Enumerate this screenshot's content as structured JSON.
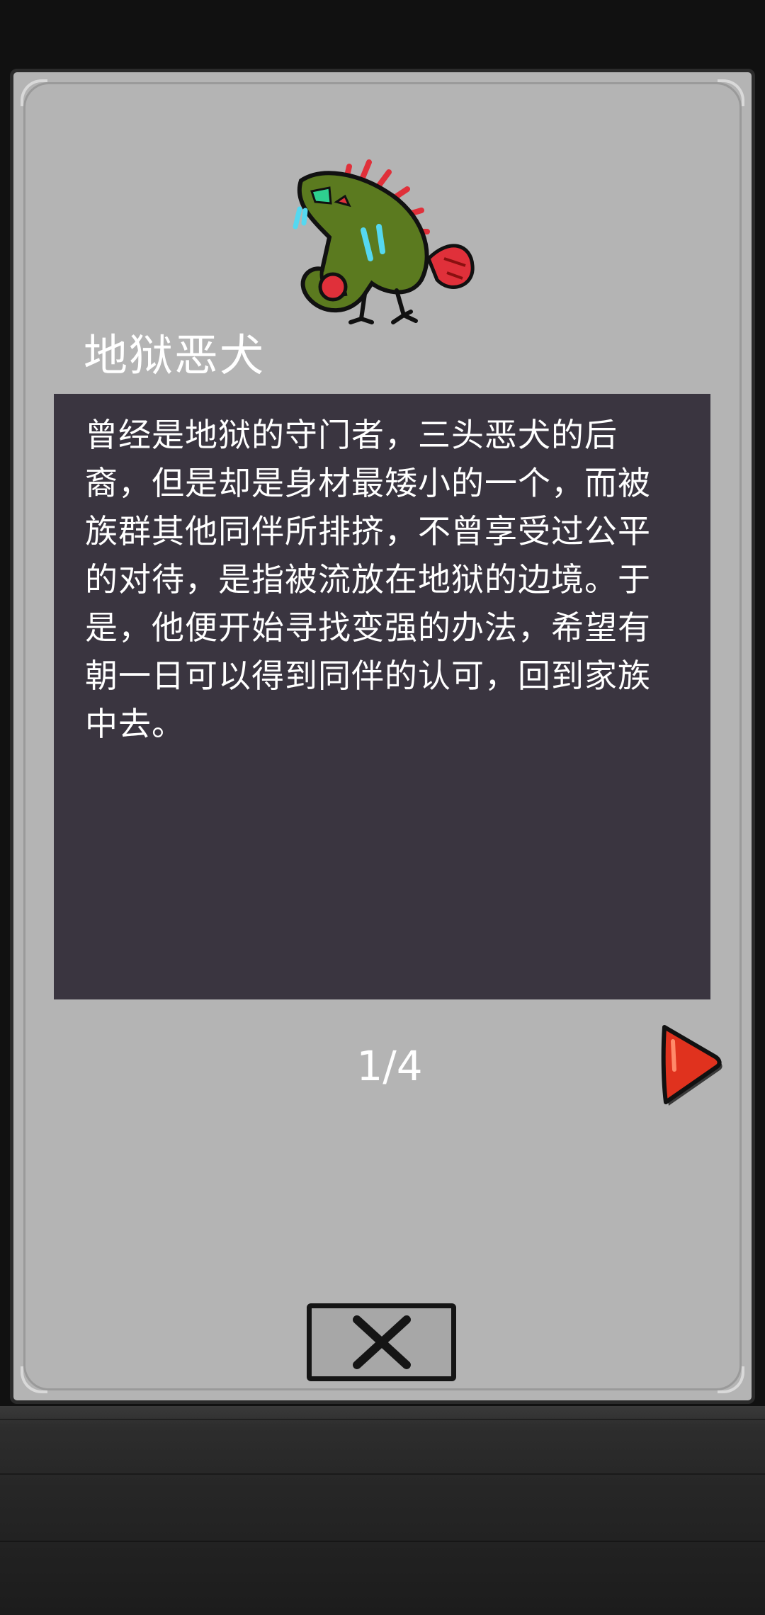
{
  "monster": {
    "name": "地狱恶犬",
    "description": "曾经是地狱的守门者，三头恶犬的后裔，但是却是身材最矮小的一个，而被族群其他同伴所排挤，不曾享受过公平的对待，是指被流放在地狱的边境。于是，他便开始寻找变强的办法，希望有朝一日可以得到同伴的认可，回到家族中去。",
    "portrait_icon": "hellhound-portrait-icon"
  },
  "pager": {
    "current": 1,
    "total": 4,
    "label": "1/4",
    "next_icon": "right-arrow-icon"
  },
  "close": {
    "icon": "close-x-icon"
  },
  "colors": {
    "panel_bg": "#b4b4b4",
    "desc_bg": "#3a3540",
    "text": "#ffffff",
    "next_arrow": "#e0321e",
    "monster_body": "#5b7a1f",
    "monster_accent": "#e0303a"
  }
}
